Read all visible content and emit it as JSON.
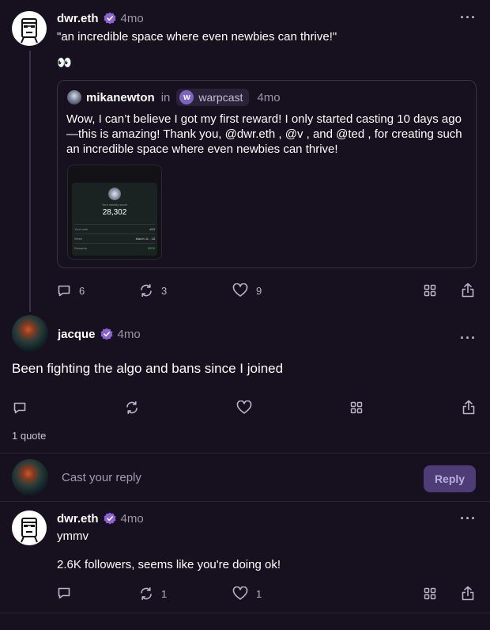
{
  "posts": [
    {
      "username": "dwr.eth",
      "time": "4mo",
      "text": "\"an incredible space where even newbies can thrive!\"",
      "emoji": "👀",
      "quote": {
        "username": "mikanewton",
        "in_label": "in",
        "channel": "warpcast",
        "time": "4mo",
        "text": "Wow, I can’t believe I got my first reward! I only started casting 10 days ago—this is amazing! Thank you, @dwr.eth , @v , and @ted , for creating such an incredible space where even newbies can thrive!",
        "image": {
          "label": "Your weekly score",
          "score": "28,302",
          "rows": [
            {
              "k": "Your rank",
              "v": "#24"
            },
            {
              "k": "Week",
              "v": "March 11 - 18"
            },
            {
              "k": "Rewards",
              "v": "$200"
            }
          ]
        }
      },
      "replies": "6",
      "recasts": "3",
      "likes": "9"
    },
    {
      "username": "jacque",
      "time": "4mo",
      "text": "Been fighting the algo and bans since I joined",
      "quote_count": "1 quote"
    },
    {
      "username": "dwr.eth",
      "time": "4mo",
      "text1": "ymmv",
      "text2": "2.6K followers, seems like you're doing ok!",
      "recasts": "1",
      "likes": "1"
    }
  ],
  "reply_box": {
    "placeholder": "Cast your reply",
    "button": "Reply"
  },
  "colors": {
    "background": "#17101f",
    "accent": "#7c65c1",
    "verified": "#8a63d2"
  }
}
